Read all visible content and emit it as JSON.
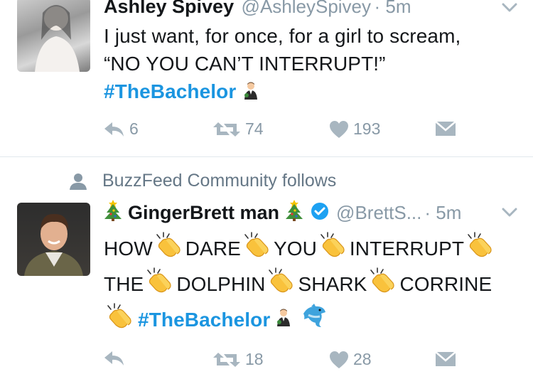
{
  "tweet1": {
    "name": "Ashley Spivey",
    "handle": "@AshleySpivey",
    "time": "· 5m",
    "line1": "I just want, for once, for a girl to scream,",
    "line2": "“NO YOU CAN’T INTERRUPT!”",
    "hashtag": "#TheBachelor",
    "reply_count": "6",
    "retweet_count": "74",
    "like_count": "193"
  },
  "social_context": {
    "text": "BuzzFeed Community follows"
  },
  "tweet2": {
    "name": "GingerBrett man",
    "handle": "@BrettS...",
    "time": "· 5m",
    "words_line1": [
      "HOW",
      "DARE",
      "YOU",
      "INTERRUPT"
    ],
    "words_line2": [
      "THE",
      "DOLPHIN",
      "SHARK",
      "CORRINE"
    ],
    "hashtag": "#TheBachelor",
    "reply_count": "",
    "retweet_count": "18",
    "like_count": "28"
  },
  "colors": {
    "text": "#14171a",
    "muted": "#8899a6",
    "link": "#1b95e0",
    "verified": "#1da1f2",
    "divider": "#e1e8ed"
  },
  "icons": {
    "reply": "reply-icon",
    "retweet": "retweet-icon",
    "like": "heart-icon",
    "dm": "envelope-icon",
    "caret": "chevron-down-icon",
    "person": "person-icon",
    "tree": "christmas-tree-emoji",
    "clap": "clapping-hands-emoji",
    "dolphin": "dolphin-emoji",
    "groom": "man-in-tuxedo-emoji"
  }
}
